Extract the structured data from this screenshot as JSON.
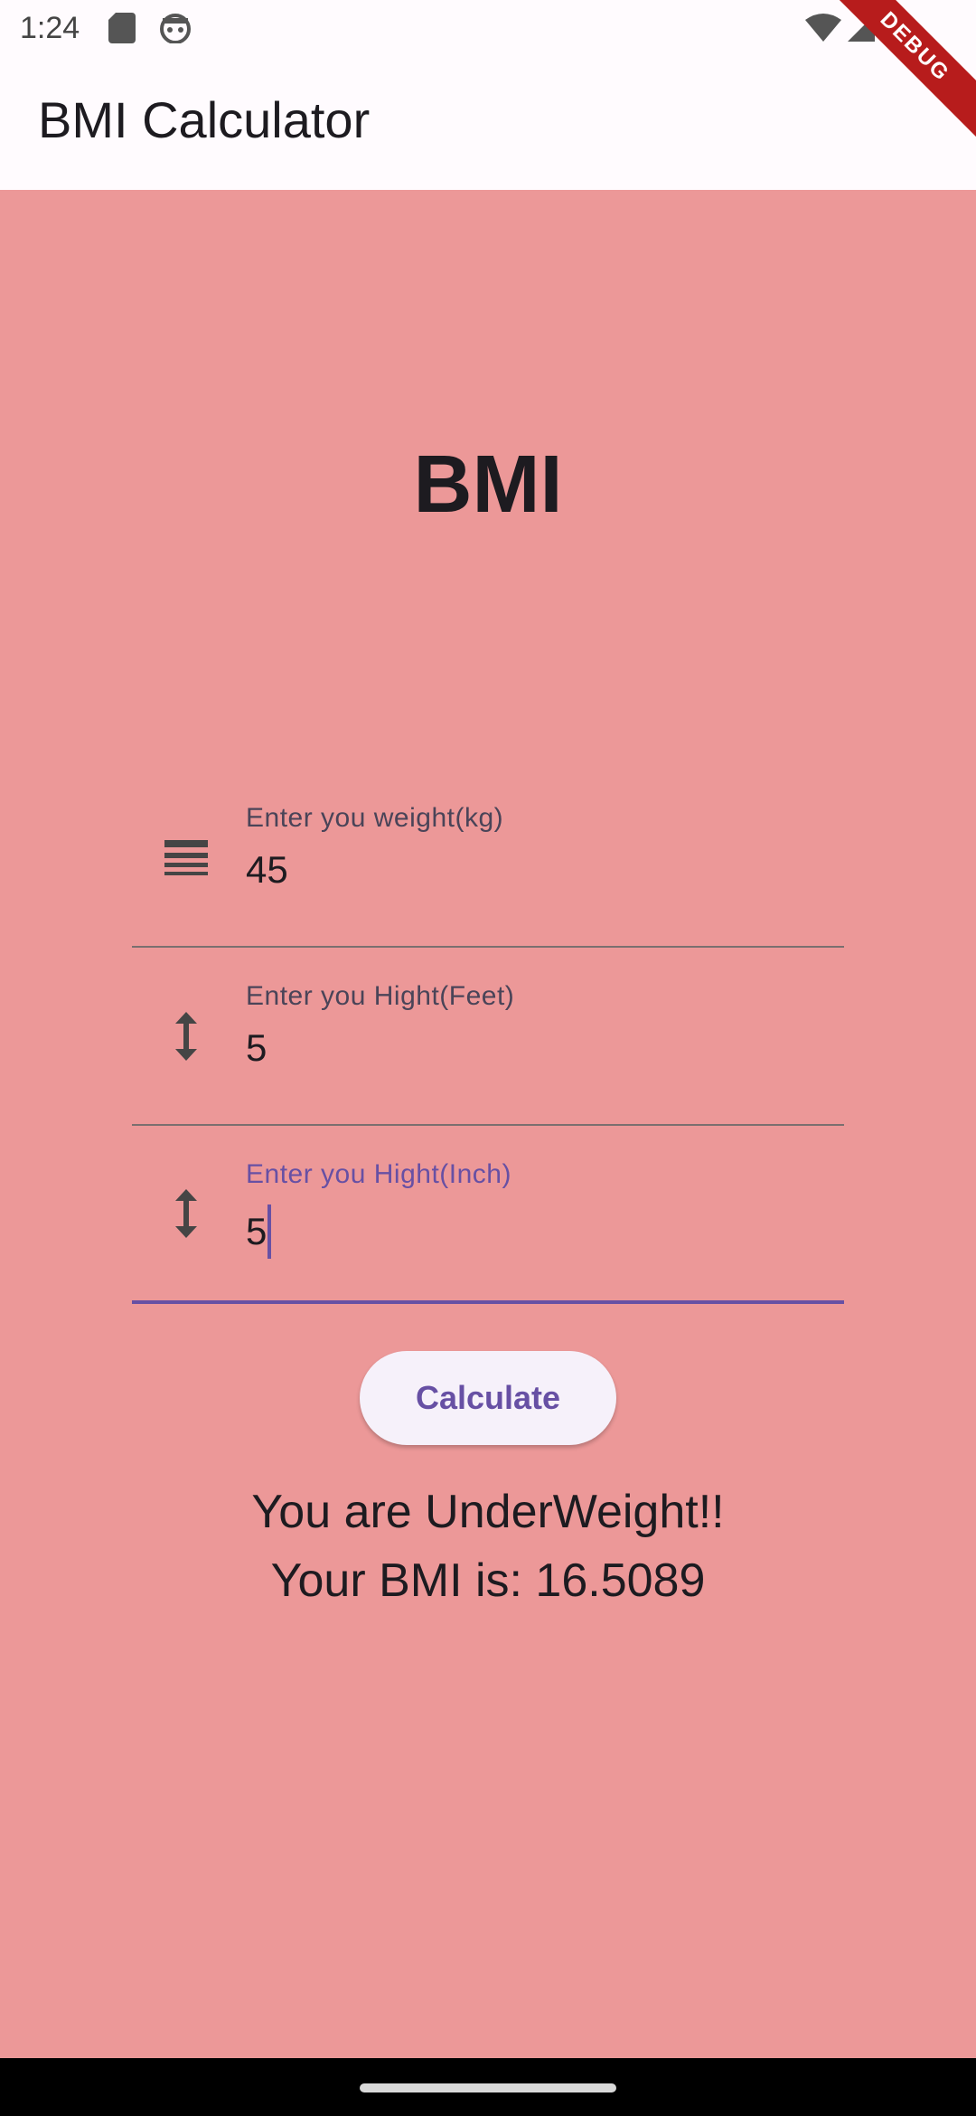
{
  "status_bar": {
    "time": "1:24",
    "left_icons": [
      "sd-card-icon",
      "android-face-icon"
    ],
    "right_icons": [
      "wifi-icon",
      "cellular-signal-icon",
      "battery-icon"
    ]
  },
  "app_bar": {
    "title": "BMI Calculator"
  },
  "debug_banner": {
    "label": "DEBUG"
  },
  "main": {
    "background_color": "#ec9898",
    "heading": "BMI",
    "fields": [
      {
        "label": "Enter you weight(kg)",
        "value": "45",
        "icon": "line-weight-icon",
        "focused": false
      },
      {
        "label": "Enter you Hight(Feet)",
        "value": "5",
        "icon": "height-icon",
        "focused": false
      },
      {
        "label": "Enter you Hight(Inch)",
        "value": "5",
        "icon": "height-icon",
        "focused": true
      }
    ],
    "calculate_label": "Calculate",
    "result_status": "You are UnderWeight!!",
    "result_bmi": "Your BMI is: 16.5089"
  },
  "colors": {
    "accent": "#6750a4",
    "app_bar": "#fffbfe",
    "debug_ribbon": "#b71c1c"
  }
}
